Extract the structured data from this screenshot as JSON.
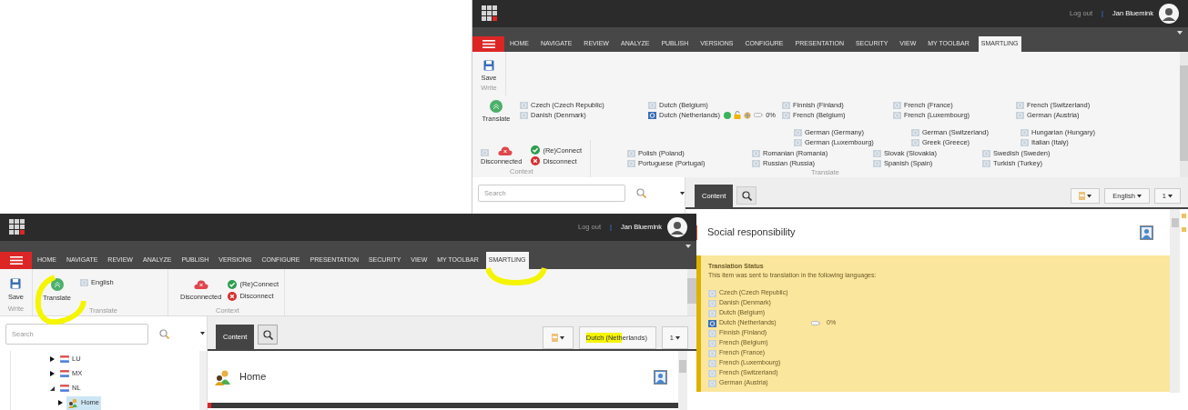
{
  "back_window": {
    "top_bar": {
      "logout": "Log out",
      "separator": "|",
      "user": "Jan Bluemink"
    },
    "tabs": [
      {
        "label": "HOME",
        "selected": false
      },
      {
        "label": "NAVIGATE",
        "selected": false
      },
      {
        "label": "REVIEW",
        "selected": false
      },
      {
        "label": "ANALYZE",
        "selected": false
      },
      {
        "label": "PUBLISH",
        "selected": false
      },
      {
        "label": "VERSIONS",
        "selected": false
      },
      {
        "label": "CONFIGURE",
        "selected": false
      },
      {
        "label": "PRESENTATION",
        "selected": false
      },
      {
        "label": "SECURITY",
        "selected": false
      },
      {
        "label": "VIEW",
        "selected": false
      },
      {
        "label": "MY TOOLBAR",
        "selected": false
      },
      {
        "label": "SMARTLING",
        "selected": true
      }
    ],
    "ribbon": {
      "save": "Save",
      "write_group": "Write",
      "translate": "Translate",
      "translate_group": "Translate",
      "language_rows": [
        [
          [
            {
              "label": "Czech (Czech Republic)",
              "active": false
            },
            {
              "label": "Danish (Denmark)",
              "active": false
            }
          ],
          [
            {
              "label": "Dutch (Belgium)",
              "active": false
            },
            {
              "label": "Dutch (Netherlands)",
              "active": true,
              "progress": "0%"
            }
          ],
          [
            {
              "label": "Finnish (Finland)",
              "active": false
            },
            {
              "label": "French (Belgium)",
              "active": false
            }
          ],
          [
            {
              "label": "French (France)",
              "active": false
            },
            {
              "label": "French (Luxembourg)",
              "active": false
            }
          ],
          [
            {
              "label": "French (Switzerland)",
              "active": false
            },
            {
              "label": "German (Austria)",
              "active": false
            }
          ]
        ],
        [
          [
            {
              "label": "German (Germany)",
              "active": false
            },
            {
              "label": "German (Luxembourg)",
              "active": false
            }
          ],
          [
            {
              "label": "German (Switzerland)",
              "active": false
            },
            {
              "label": "Greek (Greece)",
              "active": false
            }
          ],
          [
            {
              "label": "Hungarian (Hungary)",
              "active": false
            },
            {
              "label": "Italian (Italy)",
              "active": false
            }
          ]
        ],
        [
          [
            {
              "label": "Polish (Poland)",
              "active": false
            },
            {
              "label": "Portuguese (Portugal)",
              "active": false
            }
          ],
          [
            {
              "label": "Romanian (Romania)",
              "active": false
            },
            {
              "label": "Russian (Russia)",
              "active": false
            }
          ],
          [
            {
              "label": "Slovak (Slovakia)",
              "active": false
            },
            {
              "label": "Spanish (Spain)",
              "active": false
            }
          ],
          [
            {
              "label": "Swedish (Sweden)",
              "active": false
            },
            {
              "label": "Turkish (Turkey)",
              "active": false
            }
          ]
        ]
      ],
      "context": {
        "status": "Disconnected",
        "reconnect": "(Re)Connect",
        "disconnect": "Disconnect",
        "group": "Context"
      }
    },
    "search": {
      "placeholder": "Search"
    },
    "content_tab": {
      "label": "Content",
      "selected": true
    },
    "language_button": "English",
    "version_button": "1",
    "item_title": "Social responsibility",
    "translation_status": {
      "title": "Translation Status",
      "text": "This item was sent to translation in the following languages:",
      "languages": [
        {
          "label": "Czech (Czech Republic)",
          "active": false
        },
        {
          "label": "Danish (Denmark)",
          "active": false
        },
        {
          "label": "Dutch (Belgium)",
          "active": false
        },
        {
          "label": "Dutch (Netherlands)",
          "active": true,
          "progress": "0%"
        },
        {
          "label": "Finnish (Finland)",
          "active": false
        },
        {
          "label": "French (Belgium)",
          "active": false
        },
        {
          "label": "French (France)",
          "active": false
        },
        {
          "label": "French (Luxembourg)",
          "active": false
        },
        {
          "label": "French (Switzerland)",
          "active": false
        },
        {
          "label": "German (Austria)",
          "active": false
        }
      ]
    }
  },
  "front_window": {
    "top_bar": {
      "logout": "Log out",
      "separator": "|",
      "user": "Jan Bluemink"
    },
    "tabs": [
      {
        "label": "HOME",
        "selected": false
      },
      {
        "label": "NAVIGATE",
        "selected": false
      },
      {
        "label": "REVIEW",
        "selected": false
      },
      {
        "label": "ANALYZE",
        "selected": false
      },
      {
        "label": "PUBLISH",
        "selected": false
      },
      {
        "label": "VERSIONS",
        "selected": false
      },
      {
        "label": "CONFIGURE",
        "selected": false
      },
      {
        "label": "PRESENTATION",
        "selected": false
      },
      {
        "label": "SECURITY",
        "selected": false
      },
      {
        "label": "VIEW",
        "selected": false
      },
      {
        "label": "MY TOOLBAR",
        "selected": false
      },
      {
        "label": "SMARTLING",
        "selected": true
      }
    ],
    "ribbon": {
      "save": "Save",
      "write_group": "Write",
      "translate": "Translate",
      "language": "English",
      "translate_group": "Translate",
      "context": {
        "status": "Disconnected",
        "reconnect": "(Re)Connect",
        "disconnect": "Disconnect",
        "group": "Context"
      }
    },
    "search": {
      "placeholder": "Search"
    },
    "tree": [
      {
        "label": "LU",
        "expanded": false
      },
      {
        "label": "MX",
        "expanded": false
      },
      {
        "label": "NL",
        "expanded": true,
        "children": [
          {
            "label": "Home",
            "expanded": false,
            "selected": true
          }
        ]
      }
    ],
    "content_tab": {
      "label": "Content",
      "selected": true
    },
    "language_button": "Dutch (Netherlands)",
    "version_button": "1",
    "item_title": "Home"
  }
}
